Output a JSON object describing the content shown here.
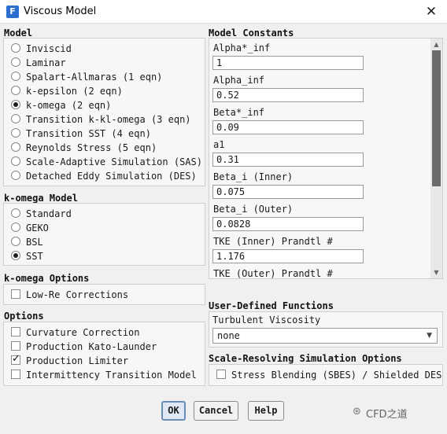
{
  "window": {
    "title": "Viscous Model",
    "app_icon_letter": "F",
    "close_glyph": "✕"
  },
  "model": {
    "heading": "Model",
    "options": [
      {
        "label": "Inviscid",
        "selected": false
      },
      {
        "label": "Laminar",
        "selected": false
      },
      {
        "label": "Spalart-Allmaras (1 eqn)",
        "selected": false
      },
      {
        "label": "k-epsilon (2 eqn)",
        "selected": false
      },
      {
        "label": "k-omega (2 eqn)",
        "selected": true
      },
      {
        "label": "Transition k-kl-omega (3 eqn)",
        "selected": false
      },
      {
        "label": "Transition SST (4 eqn)",
        "selected": false
      },
      {
        "label": "Reynolds Stress (5 eqn)",
        "selected": false
      },
      {
        "label": "Scale-Adaptive Simulation (SAS)",
        "selected": false
      },
      {
        "label": "Detached Eddy Simulation (DES)",
        "selected": false
      }
    ]
  },
  "komega_model": {
    "heading": "k-omega Model",
    "options": [
      {
        "label": "Standard",
        "selected": false
      },
      {
        "label": "GEKO",
        "selected": false
      },
      {
        "label": "BSL",
        "selected": false
      },
      {
        "label": "SST",
        "selected": true
      }
    ]
  },
  "komega_options": {
    "heading": "k-omega Options",
    "items": [
      {
        "label": "Low-Re Corrections",
        "checked": false
      }
    ]
  },
  "options": {
    "heading": "Options",
    "items": [
      {
        "label": "Curvature Correction",
        "checked": false
      },
      {
        "label": "Production Kato-Launder",
        "checked": false
      },
      {
        "label": "Production Limiter",
        "checked": true
      },
      {
        "label": "Intermittency Transition Model",
        "checked": false
      }
    ]
  },
  "model_constants": {
    "heading": "Model Constants",
    "items": [
      {
        "label": "Alpha*_inf",
        "value": "1"
      },
      {
        "label": "Alpha_inf",
        "value": "0.52"
      },
      {
        "label": "Beta*_inf",
        "value": "0.09"
      },
      {
        "label": "a1",
        "value": "0.31"
      },
      {
        "label": "Beta_i (Inner)",
        "value": "0.075"
      },
      {
        "label": "Beta_i (Outer)",
        "value": "0.0828"
      },
      {
        "label": "TKE (Inner) Prandtl #",
        "value": "1.176"
      },
      {
        "label": "TKE (Outer) Prandtl #",
        "value": ""
      }
    ],
    "scroll_up": "▲",
    "scroll_down": "▼"
  },
  "udf": {
    "heading": "User-Defined Functions",
    "turbulent_viscosity_label": "Turbulent Viscosity",
    "turbulent_viscosity_value": "none",
    "dropdown_arrow": "▼"
  },
  "srs": {
    "heading": "Scale-Resolving Simulation Options",
    "items": [
      {
        "label": "Stress Blending (SBES) / Shielded DES",
        "checked": false
      }
    ]
  },
  "buttons": {
    "ok": "OK",
    "cancel": "Cancel",
    "help": "Help"
  },
  "watermark": {
    "icon": "⊛",
    "text": "CFD之道"
  },
  "colors": {
    "accent": "#2a6fcf",
    "primary_button_border": "#6a8db8",
    "scroll_thumb": "#6b6b6b"
  }
}
